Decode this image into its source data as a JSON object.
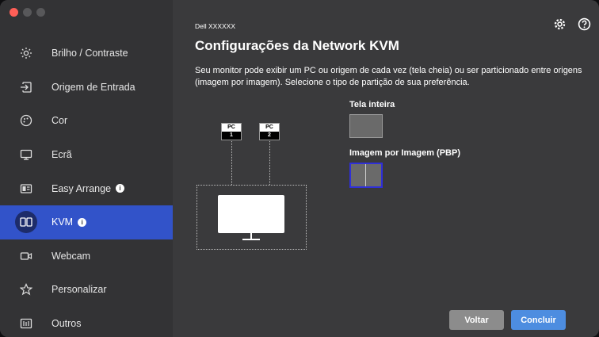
{
  "sidebar": {
    "items": [
      {
        "label": "Brilho / Contraste",
        "icon": "brightness-icon",
        "active": false,
        "info": false
      },
      {
        "label": "Origem de Entrada",
        "icon": "input-source-icon",
        "active": false,
        "info": false
      },
      {
        "label": "Cor",
        "icon": "color-icon",
        "active": false,
        "info": false
      },
      {
        "label": "Ecrã",
        "icon": "display-icon",
        "active": false,
        "info": false
      },
      {
        "label": "Easy Arrange",
        "icon": "easy-arrange-icon",
        "active": false,
        "info": true
      },
      {
        "label": "KVM",
        "icon": "kvm-icon",
        "active": true,
        "info": true
      },
      {
        "label": "Webcam",
        "icon": "webcam-icon",
        "active": false,
        "info": false
      },
      {
        "label": "Personalizar",
        "icon": "star-icon",
        "active": false,
        "info": false
      },
      {
        "label": "Outros",
        "icon": "others-icon",
        "active": false,
        "info": false
      }
    ]
  },
  "header": {
    "device": "Dell XXXXXX",
    "title": "Configurações da Network KVM",
    "description": "Seu monitor pode exibir um PC ou origem de cada vez (tela cheia) ou ser particionado entre origens (imagem por imagem). Selecione o tipo de partição de sua preferência."
  },
  "diagram": {
    "pc1_label": "PC",
    "pc1_num": "1",
    "pc2_label": "PC",
    "pc2_num": "2"
  },
  "options": {
    "full_label": "Tela inteira",
    "pbp_label": "Imagem por Imagem (PBP)",
    "selected": "pbp"
  },
  "buttons": {
    "back": "Voltar",
    "done": "Concluir"
  },
  "colors": {
    "accent": "#3253c9",
    "done": "#4d8de0",
    "selected_border": "#2f2fd8"
  }
}
